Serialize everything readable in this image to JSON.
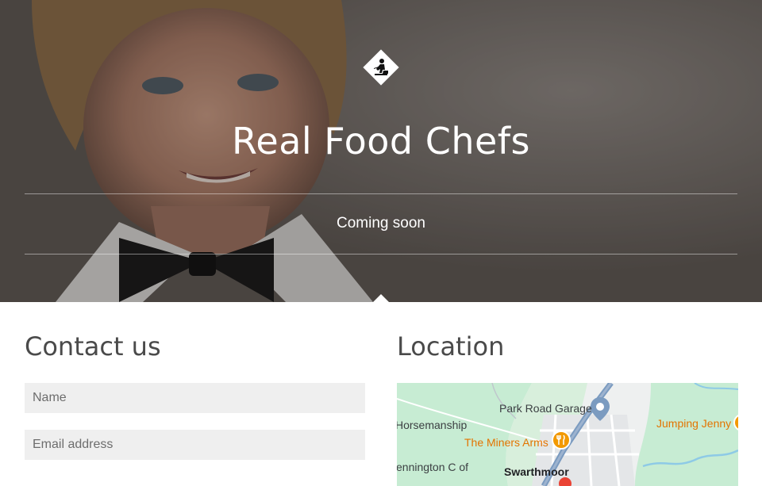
{
  "hero": {
    "site_title": "Real Food Chefs",
    "tagline": "Coming soon",
    "logo_icon": "construction-worker-icon"
  },
  "contact": {
    "title": "Contact us",
    "name_placeholder": "Name",
    "email_placeholder": "Email address"
  },
  "location": {
    "title": "Location",
    "map": {
      "labels": {
        "park_road_garage": "Park Road Garage",
        "horsemanship": "Horsemanship",
        "miners_arms": "The Miners Arms",
        "jumping_jenny": "Jumping Jenny",
        "pennington": "ennington C of",
        "swarthmoor": "Swarthmoor"
      },
      "pin_icons": [
        "map-pin-icon",
        "restaurant-pin-icon"
      ]
    }
  },
  "colors": {
    "accent_orange": "#e37400",
    "map_green": "#c7ecd3",
    "map_road_blue": "#7b9bc0",
    "field_bg": "#efefef"
  }
}
